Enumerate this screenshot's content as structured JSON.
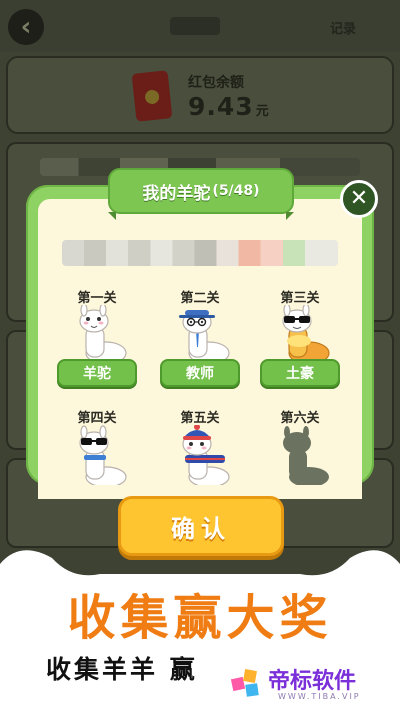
{
  "header": {
    "back_icon": "chevron-left-icon",
    "record_label": "记录"
  },
  "balance": {
    "label": "红包余额",
    "amount": "9.43",
    "unit": "元",
    "icon": "red-envelope-icon"
  },
  "modal": {
    "title": "我的羊驼",
    "count": "(5/48)",
    "close_icon": "close-icon",
    "levels": [
      {
        "name": "第一关",
        "label": "羊驼",
        "unlocked": true
      },
      {
        "name": "第二关",
        "label": "教师",
        "unlocked": true
      },
      {
        "name": "第三关",
        "label": "土豪",
        "unlocked": true
      },
      {
        "name": "第四关",
        "label": "",
        "unlocked": true
      },
      {
        "name": "第五关",
        "label": "",
        "unlocked": true
      },
      {
        "name": "第六关",
        "label": "",
        "unlocked": false
      }
    ],
    "confirm_label": "确认"
  },
  "promo": {
    "title": "收集赢大奖",
    "subtitle": "收集羊羊 赢"
  },
  "watermark": {
    "name": "帝标软件",
    "url": "WWW.TIBA.VIP"
  },
  "colors": {
    "modal_green": "#8dd262",
    "button_green": "#73c04a",
    "confirm_yellow": "#ffc531",
    "promo_orange": "#f07c14",
    "watermark_purple": "#7b2fd9"
  }
}
